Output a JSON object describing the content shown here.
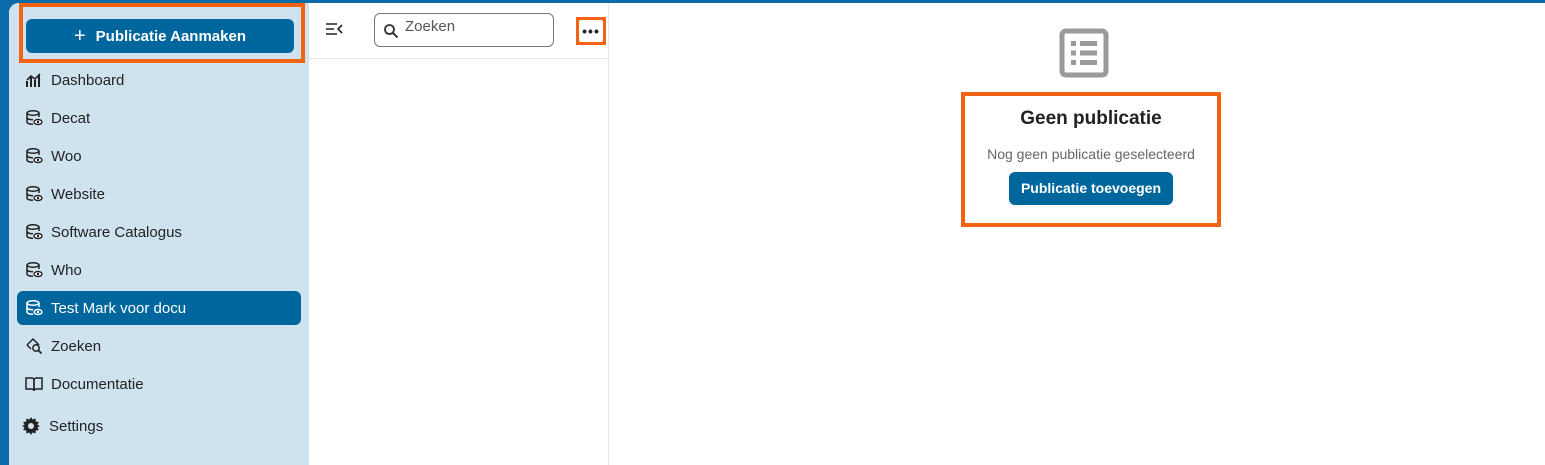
{
  "sidebar": {
    "create_label": "Publicatie Aanmaken",
    "items": [
      {
        "label": "Dashboard",
        "icon": "chart-icon"
      },
      {
        "label": "Decat",
        "icon": "database-eye-icon"
      },
      {
        "label": "Woo",
        "icon": "database-eye-icon"
      },
      {
        "label": "Website",
        "icon": "database-eye-icon"
      },
      {
        "label": "Software Catalogus",
        "icon": "database-eye-icon"
      },
      {
        "label": "Who",
        "icon": "database-eye-icon"
      },
      {
        "label": "Test Mark voor docu",
        "icon": "database-eye-icon",
        "active": true
      },
      {
        "label": "Zoeken",
        "icon": "search-zoom-icon"
      },
      {
        "label": "Documentatie",
        "icon": "book-icon"
      }
    ],
    "settings_label": "Settings"
  },
  "list": {
    "search_placeholder": "Zoeken",
    "more_label": "•••"
  },
  "main": {
    "empty_title": "Geen publicatie",
    "empty_subtitle": "Nog geen publicatie geselecteerd",
    "add_button": "Publicatie toevoegen"
  },
  "colors": {
    "brand": "#00679e",
    "sidebar_bg": "#cfe3ef",
    "highlight": "#f06414"
  }
}
